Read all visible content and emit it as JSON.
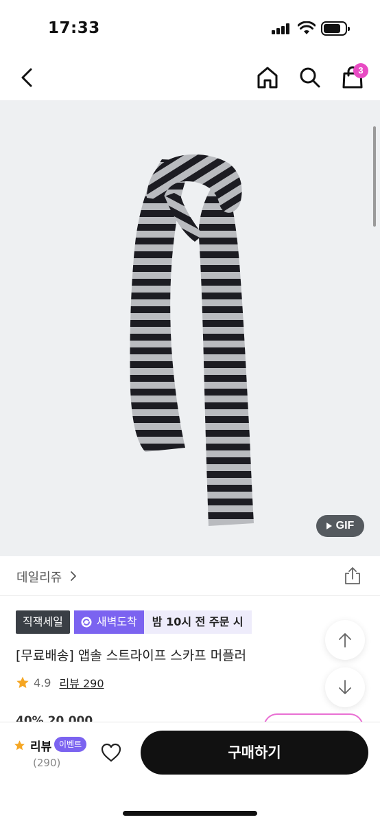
{
  "status_bar": {
    "time": "17:33"
  },
  "nav": {
    "back_icon": "chevron-left-icon",
    "home_icon": "home-icon",
    "search_icon": "search-icon",
    "cart_icon": "shopping-bag-icon",
    "cart_count": "3"
  },
  "product_image": {
    "gif_label": "GIF",
    "stripe_colors": [
      "#1c1c22",
      "#b9bbbf"
    ]
  },
  "brand": {
    "name": "데일리쥬",
    "share_icon": "share-icon"
  },
  "tags": {
    "sale": "직잭세일",
    "dawn": "새벽도착",
    "order_cutoff": "밤 10시 전 주문 시"
  },
  "product": {
    "title": "[무료배송] 앱솔 스트라이프 스카프 머플러",
    "rating": "4.9",
    "reviews_link": "리뷰 290",
    "price_peek": "40% 20,000"
  },
  "bottom_bar": {
    "review_label": "리뷰",
    "event_badge": "이벤트",
    "review_count": "(290)",
    "buy_label": "구매하기"
  },
  "colors": {
    "accent_purple": "#7b63f0",
    "badge_pink": "#e84bc3",
    "star_orange": "#f5a623",
    "button_black": "#111111"
  }
}
